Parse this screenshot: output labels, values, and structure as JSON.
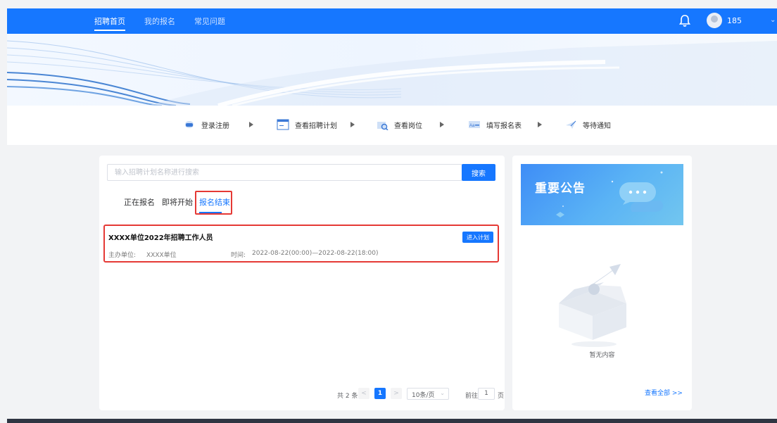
{
  "nav": {
    "items": [
      "招聘首页",
      "我的报名",
      "常见问题"
    ],
    "active_index": 0,
    "username": "185"
  },
  "steps": {
    "items": [
      "登录注册",
      "查看招聘计划",
      "查看岗位",
      "填写报名表",
      "等待通知"
    ]
  },
  "search": {
    "placeholder": "输入招聘计划名称进行搜索",
    "value": "",
    "button_label": "搜索"
  },
  "tabs": {
    "items": [
      "正在报名",
      "即将开始",
      "报名结束"
    ],
    "active_index": 2
  },
  "plan": {
    "title": "XXXX单位2022年招聘工作人员",
    "button_label": "进入计划",
    "org_label": "主办单位:",
    "org": "XXXX单位",
    "time_label": "时间:",
    "time": "2022-08-22(00:00)—2022-08-22(18:00)"
  },
  "pagination": {
    "total_text": "共 2 条",
    "prev": "<",
    "current_page": "1",
    "next": ">",
    "page_size": "10条/页",
    "goto_label": "前往",
    "goto_value": "1",
    "page_unit": "页"
  },
  "notice": {
    "title": "重要公告",
    "empty_text": "暂无内容",
    "view_all": "查看全部 >>"
  },
  "colors": {
    "primary": "#1677ff",
    "highlight": "#e53935"
  }
}
